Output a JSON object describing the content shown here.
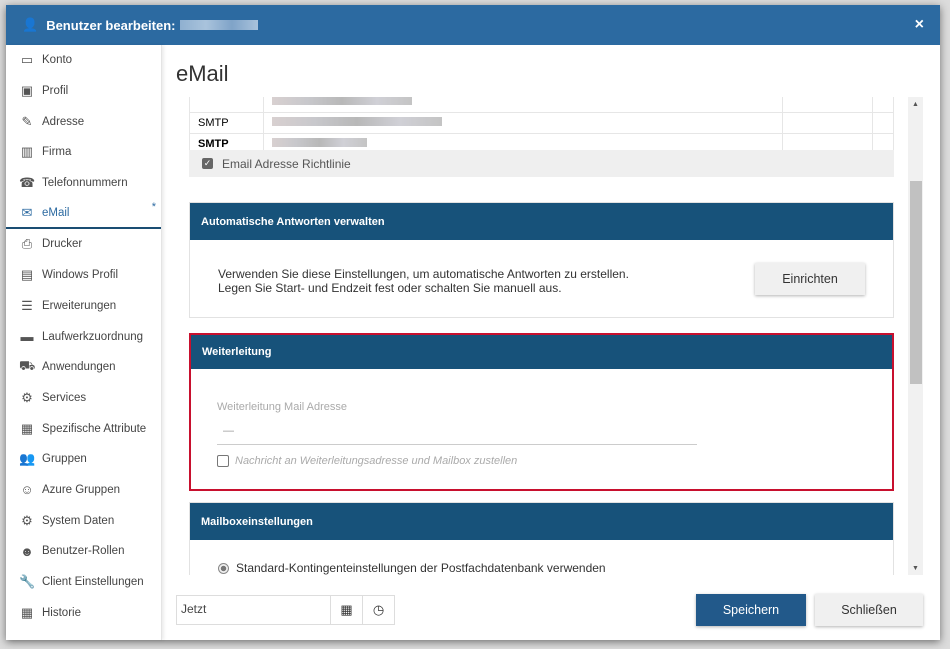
{
  "window": {
    "title": "Benutzer bearbeiten:",
    "close": "×"
  },
  "sidebar": {
    "items": [
      {
        "label": "Konto",
        "icon": "credit-card-icon",
        "glyph": "▭"
      },
      {
        "label": "Profil",
        "icon": "profile-card-icon",
        "glyph": "▣"
      },
      {
        "label": "Adresse",
        "icon": "edit-icon",
        "glyph": "✎"
      },
      {
        "label": "Firma",
        "icon": "building-icon",
        "glyph": "▥"
      },
      {
        "label": "Telefonnummern",
        "icon": "phone-icon",
        "glyph": "☎"
      },
      {
        "label": "eMail",
        "icon": "envelope-icon",
        "glyph": "✉",
        "active": true,
        "badge": "*"
      },
      {
        "label": "Drucker",
        "icon": "printer-icon",
        "glyph": "⎙"
      },
      {
        "label": "Windows Profil",
        "icon": "save-icon",
        "glyph": "▤"
      },
      {
        "label": "Erweiterungen",
        "icon": "list-icon",
        "glyph": "☰"
      },
      {
        "label": "Laufwerkzuordnung",
        "icon": "drive-icon",
        "glyph": "▬"
      },
      {
        "label": "Anwendungen",
        "icon": "cart-icon",
        "glyph": "⛟"
      },
      {
        "label": "Services",
        "icon": "gear-icon",
        "glyph": "⚙"
      },
      {
        "label": "Spezifische Attribute",
        "icon": "document-icon",
        "glyph": "▦"
      },
      {
        "label": "Gruppen",
        "icon": "users-icon",
        "glyph": "👥"
      },
      {
        "label": "Azure Gruppen",
        "icon": "group-outline-icon",
        "glyph": "☺"
      },
      {
        "label": "System Daten",
        "icon": "gears-icon",
        "glyph": "⚙"
      },
      {
        "label": "Benutzer-Rollen",
        "icon": "user-gear-icon",
        "glyph": "☻"
      },
      {
        "label": "Client Einstellungen",
        "icon": "wrench-icon",
        "glyph": "🔧"
      },
      {
        "label": "Historie",
        "icon": "calendar-list-icon",
        "glyph": "▦"
      }
    ]
  },
  "main": {
    "title": "eMail",
    "addresses": [
      {
        "type": ""
      },
      {
        "type": "SMTP"
      },
      {
        "type": "SMTP",
        "bold": true
      }
    ],
    "policy_checkbox": {
      "label": "Email Adresse Richtlinie",
      "checked": true
    },
    "auto_reply": {
      "header": "Automatische Antworten verwalten",
      "line1": "Verwenden Sie diese Einstellungen, um automatische Antworten zu erstellen.",
      "line2": "Legen Sie Start- und Endzeit fest oder schalten Sie manuell aus.",
      "button": "Einrichten"
    },
    "forwarding": {
      "header": "Weiterleitung",
      "field_label": "Weiterleitung Mail Adresse",
      "field_value": "—",
      "checkbox_label": "Nachricht an Weiterleitungsadresse und Mailbox zustellen",
      "checked": false,
      "highlight_color": "#c8102e"
    },
    "mailbox": {
      "header": "Mailboxeinstellungen",
      "radio_label": "Standard-Kontingenteinstellungen der Postfachdatenbank verwenden",
      "selected": true
    }
  },
  "footer": {
    "date_value": "Jetzt",
    "save": "Speichern",
    "close": "Schließen"
  },
  "colors": {
    "header": "#2c6aa1",
    "section": "#17527a",
    "primary_button": "#22598a"
  }
}
